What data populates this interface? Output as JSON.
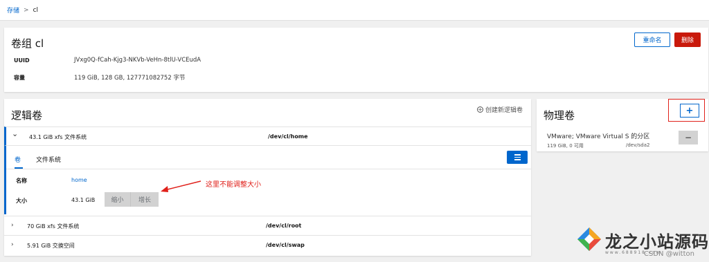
{
  "breadcrumb": {
    "root": "存储",
    "separator": ">",
    "current": "cl"
  },
  "volume_group": {
    "title": "卷组 cl",
    "uuid_label": "UUID",
    "uuid_value": "JVxg0Q-fCah-Kjg3-NKVb-VeHn-8tlU-VCEudA",
    "capacity_label": "容量",
    "capacity_value": "119 GiB, 128 GB, 127771082752 字节",
    "rename_label": "重命名",
    "delete_label": "删除"
  },
  "logical_volumes": {
    "title": "逻辑卷",
    "create_label": "创建新逻辑卷",
    "rows": [
      {
        "name": "43.1 GiB xfs 文件系统",
        "path": "/dev/cl/home",
        "chevron": "⌄"
      },
      {
        "name": "70 GiB xfs 文件系统",
        "path": "/dev/cl/root",
        "chevron": "›"
      },
      {
        "name": "5.91 GiB 交换空间",
        "path": "/dev/cl/swap",
        "chevron": "›"
      }
    ],
    "detail": {
      "tabs": [
        "卷",
        "文件系统"
      ],
      "name_label": "名称",
      "name_value": "home",
      "size_label": "大小",
      "size_value": "43.1 GiB",
      "shrink_label": "缩小",
      "grow_label": "增长"
    }
  },
  "annotation": {
    "text": "这里不能调整大小",
    "color": "#e0201a"
  },
  "physical_volumes": {
    "title": "物理卷",
    "add_label": "+",
    "item_name": "VMware; VMware Virtual S 的分区",
    "item_size": "119 GiB, 0 可用",
    "item_device": "/dev/sda2",
    "remove_label": "−"
  },
  "watermark": {
    "site_name": "龙之小站源码",
    "url": "www.688918.com",
    "credit": "CSDN @witton"
  },
  "colors": {
    "accent": "#0066cc",
    "danger": "#c9190b",
    "annotation": "#e0201a"
  }
}
